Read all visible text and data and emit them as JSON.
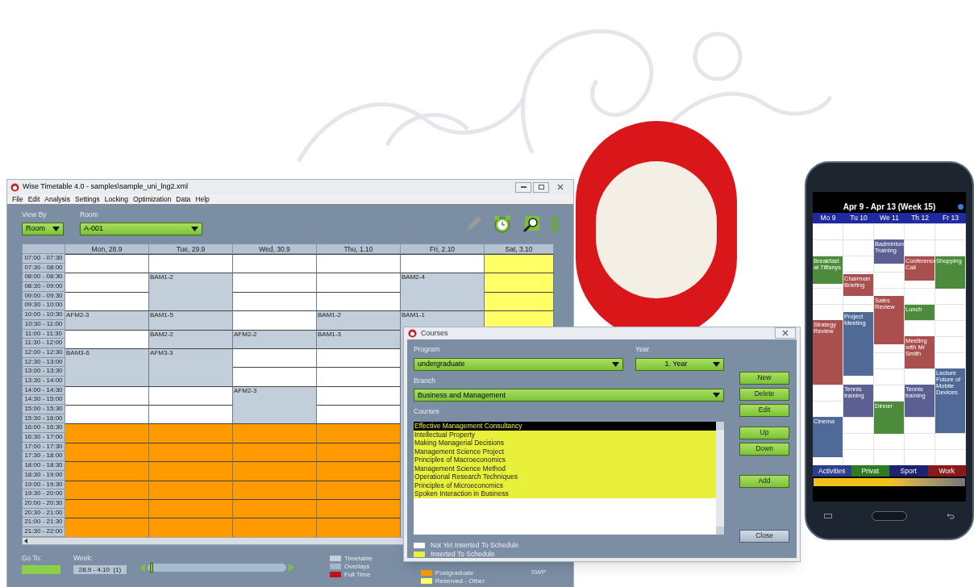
{
  "window": {
    "title": "Wise Timetable 4.0 - samples\\sample_uni_lng2.xml",
    "menu": [
      "File",
      "Edit",
      "Analysis",
      "Settings",
      "Locking",
      "Optimization",
      "Data",
      "Help"
    ]
  },
  "toolbar": {
    "view_by": {
      "label": "View By",
      "value": "Room"
    },
    "room": {
      "label": "Room",
      "value": "A-001"
    }
  },
  "timetable": {
    "days": [
      "Mon, 28.9",
      "Tue, 29.9",
      "Wed, 30.9",
      "Thu, 1.10",
      "Fri, 2.10",
      "Sat, 3.10"
    ],
    "rows": [
      {
        "time": "07:00 - 07:30",
        "cells": [
          {
            "kind": "free",
            "start": true
          },
          {
            "kind": "free",
            "start": true
          },
          {
            "kind": "free",
            "start": true
          },
          {
            "kind": "free",
            "start": true
          },
          {
            "kind": "free",
            "start": true
          },
          {
            "kind": "reserved",
            "start": true
          }
        ]
      },
      {
        "time": "07:30 - 08:00",
        "cells": [
          {
            "kind": "free",
            "start": false
          },
          {
            "kind": "free",
            "start": false
          },
          {
            "kind": "free",
            "start": false
          },
          {
            "kind": "free",
            "start": false
          },
          {
            "kind": "free",
            "start": false
          },
          {
            "kind": "reserved",
            "start": false
          }
        ]
      },
      {
        "time": "08:00 - 08:30",
        "cells": [
          {
            "kind": "free",
            "start": true
          },
          {
            "kind": "booked",
            "start": true,
            "label": "BAM1-2"
          },
          {
            "kind": "free",
            "start": true
          },
          {
            "kind": "free",
            "start": true
          },
          {
            "kind": "booked",
            "start": true,
            "label": "BAM2-4"
          },
          {
            "kind": "reserved",
            "start": true
          }
        ]
      },
      {
        "time": "08:30 - 09:00",
        "cells": [
          {
            "kind": "free",
            "start": false
          },
          {
            "kind": "booked",
            "start": false
          },
          {
            "kind": "free",
            "start": false
          },
          {
            "kind": "free",
            "start": false
          },
          {
            "kind": "booked",
            "start": false
          },
          {
            "kind": "reserved",
            "start": false
          }
        ]
      },
      {
        "time": "09:00 - 09:30",
        "cells": [
          {
            "kind": "free",
            "start": true
          },
          {
            "kind": "booked",
            "start": false
          },
          {
            "kind": "free",
            "start": true
          },
          {
            "kind": "free",
            "start": true
          },
          {
            "kind": "booked",
            "start": false
          },
          {
            "kind": "reserved",
            "start": true
          }
        ]
      },
      {
        "time": "09:30 - 10:00",
        "cells": [
          {
            "kind": "free",
            "start": false
          },
          {
            "kind": "booked",
            "start": false
          },
          {
            "kind": "free",
            "start": false
          },
          {
            "kind": "free",
            "start": false
          },
          {
            "kind": "booked",
            "start": false
          },
          {
            "kind": "reserved",
            "start": false
          }
        ]
      },
      {
        "time": "10:00 - 10:30",
        "cells": [
          {
            "kind": "booked",
            "start": true,
            "label": "AFM2-3"
          },
          {
            "kind": "booked",
            "start": true,
            "label": "BAM1-5"
          },
          {
            "kind": "free",
            "start": true
          },
          {
            "kind": "booked",
            "start": true,
            "label": "BAM1-2"
          },
          {
            "kind": "booked",
            "start": true,
            "label": "BAM1-1"
          },
          {
            "kind": "reserved",
            "start": true
          }
        ]
      },
      {
        "time": "10:30 - 11:00",
        "cells": [
          {
            "kind": "booked",
            "start": false
          },
          {
            "kind": "booked",
            "start": false
          },
          {
            "kind": "free",
            "start": false
          },
          {
            "kind": "booked",
            "start": false
          },
          {
            "kind": "booked",
            "start": false
          },
          {
            "kind": "reserved",
            "start": false
          }
        ]
      },
      {
        "time": "11:00 - 11:30",
        "cells": [
          {
            "kind": "free",
            "start": true
          },
          {
            "kind": "booked",
            "start": true,
            "label": "BAM2-2"
          },
          {
            "kind": "booked",
            "start": true,
            "label": "AFM2-2"
          },
          {
            "kind": "booked",
            "start": true,
            "label": "BAM1-3"
          }
        ]
      },
      {
        "time": "11:30 - 12:00",
        "cells": [
          {
            "kind": "free",
            "start": false
          },
          {
            "kind": "booked",
            "start": false
          },
          {
            "kind": "booked",
            "start": false
          },
          {
            "kind": "booked",
            "start": false
          }
        ]
      },
      {
        "time": "12:00 - 12:30",
        "cells": [
          {
            "kind": "booked",
            "start": true,
            "label": "BAM3-6"
          },
          {
            "kind": "booked",
            "start": true,
            "label": "AFM3-3"
          },
          {
            "kind": "free",
            "start": true
          },
          {
            "kind": "free",
            "start": true
          }
        ]
      },
      {
        "time": "12:30 - 13:00",
        "cells": [
          {
            "kind": "booked",
            "start": false
          },
          {
            "kind": "booked",
            "start": false
          },
          {
            "kind": "free",
            "start": false
          },
          {
            "kind": "free",
            "start": false
          }
        ]
      },
      {
        "time": "13:00 - 13:30",
        "cells": [
          {
            "kind": "booked",
            "start": false
          },
          {
            "kind": "booked",
            "start": false
          },
          {
            "kind": "free",
            "start": true
          },
          {
            "kind": "free",
            "start": true
          }
        ]
      },
      {
        "time": "13:30 - 14:00",
        "cells": [
          {
            "kind": "booked",
            "start": false
          },
          {
            "kind": "booked",
            "start": false
          },
          {
            "kind": "free",
            "start": false
          },
          {
            "kind": "free",
            "start": false
          }
        ]
      },
      {
        "time": "14:00 - 14:30",
        "cells": [
          {
            "kind": "free",
            "start": true
          },
          {
            "kind": "free",
            "start": true
          },
          {
            "kind": "booked",
            "start": true,
            "label": "AFM2-3"
          },
          {
            "kind": "free",
            "start": true
          }
        ]
      },
      {
        "time": "14:30 - 15:00",
        "cells": [
          {
            "kind": "free",
            "start": false
          },
          {
            "kind": "free",
            "start": false
          },
          {
            "kind": "booked",
            "start": false
          },
          {
            "kind": "free",
            "start": false
          }
        ]
      },
      {
        "time": "15:00 - 15:30",
        "cells": [
          {
            "kind": "free",
            "start": true
          },
          {
            "kind": "free",
            "start": true
          },
          {
            "kind": "booked",
            "start": false
          },
          {
            "kind": "free",
            "start": true
          }
        ]
      },
      {
        "time": "15:30 - 16:00",
        "cells": [
          {
            "kind": "free",
            "start": false
          },
          {
            "kind": "free",
            "start": false
          },
          {
            "kind": "booked",
            "start": false
          },
          {
            "kind": "free",
            "start": false
          }
        ]
      },
      {
        "time": "16:00 - 16:30",
        "cells": [
          {
            "kind": "postgraduate",
            "start": true
          },
          {
            "kind": "postgraduate",
            "start": true
          },
          {
            "kind": "postgraduate",
            "start": true
          },
          {
            "kind": "postgraduate",
            "start": true
          }
        ]
      },
      {
        "time": "16:30 - 17:00",
        "cells": [
          {
            "kind": "postgraduate",
            "start": false
          },
          {
            "kind": "postgraduate",
            "start": false
          },
          {
            "kind": "postgraduate",
            "start": false
          },
          {
            "kind": "postgraduate",
            "start": false
          }
        ]
      },
      {
        "time": "17:00 - 17:30",
        "cells": [
          {
            "kind": "postgraduate",
            "start": true
          },
          {
            "kind": "postgraduate",
            "start": true
          },
          {
            "kind": "postgraduate",
            "start": true
          },
          {
            "kind": "postgraduate",
            "start": true
          }
        ]
      },
      {
        "time": "17:30 - 18:00",
        "cells": [
          {
            "kind": "postgraduate",
            "start": false
          },
          {
            "kind": "postgraduate",
            "start": false
          },
          {
            "kind": "postgraduate",
            "start": false
          },
          {
            "kind": "postgraduate",
            "start": false
          }
        ]
      },
      {
        "time": "18:00 - 18:30",
        "cells": [
          {
            "kind": "postgraduate",
            "start": true
          },
          {
            "kind": "postgraduate",
            "start": true
          },
          {
            "kind": "postgraduate",
            "start": true
          },
          {
            "kind": "postgraduate",
            "start": true
          }
        ]
      },
      {
        "time": "18:30 - 19:00",
        "cells": [
          {
            "kind": "postgraduate",
            "start": false
          },
          {
            "kind": "postgraduate",
            "start": false
          },
          {
            "kind": "postgraduate",
            "start": false
          },
          {
            "kind": "postgraduate",
            "start": false
          }
        ]
      },
      {
        "time": "19:00 - 19:30",
        "cells": [
          {
            "kind": "postgraduate",
            "start": true
          },
          {
            "kind": "postgraduate",
            "start": true
          },
          {
            "kind": "postgraduate",
            "start": true
          },
          {
            "kind": "postgraduate",
            "start": true
          }
        ]
      },
      {
        "time": "19:30 - 20:00",
        "cells": [
          {
            "kind": "postgraduate",
            "start": false
          },
          {
            "kind": "postgraduate",
            "start": false
          },
          {
            "kind": "postgraduate",
            "start": false
          },
          {
            "kind": "postgraduate",
            "start": false
          }
        ]
      },
      {
        "time": "20:00 - 20:30",
        "cells": [
          {
            "kind": "postgraduate",
            "start": true
          },
          {
            "kind": "postgraduate",
            "start": true
          },
          {
            "kind": "postgraduate",
            "start": true
          },
          {
            "kind": "postgraduate",
            "start": true
          }
        ]
      },
      {
        "time": "20:30 - 21:00",
        "cells": [
          {
            "kind": "postgraduate",
            "start": false
          },
          {
            "kind": "postgraduate",
            "start": false
          },
          {
            "kind": "postgraduate",
            "start": false
          },
          {
            "kind": "postgraduate",
            "start": false
          }
        ]
      },
      {
        "time": "21:00 - 21:30",
        "cells": [
          {
            "kind": "postgraduate",
            "start": true
          },
          {
            "kind": "postgraduate",
            "start": true
          },
          {
            "kind": "postgraduate",
            "start": true
          },
          {
            "kind": "postgraduate",
            "start": true
          }
        ]
      },
      {
        "time": "21:30 - 22:00",
        "cells": [
          {
            "kind": "postgraduate",
            "start": false
          },
          {
            "kind": "postgraduate",
            "start": false
          },
          {
            "kind": "postgraduate",
            "start": false
          },
          {
            "kind": "postgraduate",
            "start": false
          }
        ]
      }
    ]
  },
  "footer": {
    "go_to": {
      "label": "Go To:"
    },
    "week": {
      "label": "Week:",
      "value": "28.9 - 4.10  (1)"
    },
    "week_slider": {
      "level": 0.02
    },
    "legend": [
      {
        "label": "Timetable",
        "color": "#c5d0dc"
      },
      {
        "label": "Overlays",
        "color": "#a6b6c9"
      },
      {
        "label": "Full Time",
        "color": "#c0101a"
      }
    ],
    "legend_2": [
      {
        "label": "Postgraduate",
        "color": "#ff9a00"
      },
      {
        "label": "Reserved - Other",
        "color": "#ffff66"
      }
    ],
    "code": "SWP"
  },
  "courses_dialog": {
    "title": "Courses",
    "program": {
      "label": "Program",
      "value": "undergraduate"
    },
    "year": {
      "label": "Year",
      "value": "1. Year"
    },
    "branch": {
      "label": "Branch",
      "value": "Business and Management"
    },
    "courses_label": "Courses",
    "courses": [
      {
        "name": "Effective Management Consultancy",
        "selected": true,
        "inserted": true
      },
      {
        "name": "Intellectual Property",
        "selected": false,
        "inserted": true
      },
      {
        "name": "Making Managerial Decisions",
        "selected": false,
        "inserted": true
      },
      {
        "name": "Management Science Project",
        "selected": false,
        "inserted": true
      },
      {
        "name": "Principles of Macroeconomics",
        "selected": false,
        "inserted": true
      },
      {
        "name": "Management Science Method",
        "selected": false,
        "inserted": true
      },
      {
        "name": "Operational Research Techniques",
        "selected": false,
        "inserted": true
      },
      {
        "name": "Principles of Microeconomics",
        "selected": false,
        "inserted": true
      },
      {
        "name": "Spoken Interaction in Business",
        "selected": false,
        "inserted": true
      }
    ],
    "buttons": [
      "New",
      "Delete",
      "Edit",
      "Up",
      "Down",
      "Add",
      "Close"
    ],
    "legend": [
      {
        "label": "Not Yet Inserted To Schedule",
        "color": "#ffffff"
      },
      {
        "label": "Inserted To Schedule",
        "color": "#e8f03a"
      }
    ]
  },
  "phone": {
    "title": "Apr 9 - Apr 13 (Week 15)",
    "days": [
      "Mo 9",
      "Tu 10",
      "We 11",
      "Th 12",
      "Fr 13"
    ],
    "events": [
      {
        "title": "Badminton Training",
        "color": "#5b5f92"
      },
      {
        "title": "Breakfast at Tiffanys",
        "color": "#4c8a3c"
      },
      {
        "title": "Conference Call",
        "color": "#a9504f"
      },
      {
        "title": "Shopping",
        "color": "#4c8a3c"
      },
      {
        "title": "Chairman Briefing",
        "color": "#a9504f"
      },
      {
        "title": "Sales Review",
        "color": "#a9504f"
      },
      {
        "title": "Lunch",
        "color": "#4c8a3c"
      },
      {
        "title": "Project Meeting",
        "color": "#4f6a97"
      },
      {
        "title": "Strategy Review",
        "color": "#a9504f"
      },
      {
        "title": "Meeting with Mr Smith",
        "color": "#a9504f"
      },
      {
        "title": "Tennis training",
        "color": "#5b5f92"
      },
      {
        "title": "Dinner",
        "color": "#4c8a3c"
      },
      {
        "title": "Tennis training",
        "color": "#5b5f92"
      },
      {
        "title": "Lecture Future of Mobile Devices",
        "color": "#4f6a97"
      },
      {
        "title": "Cinema",
        "color": "#4f6a97"
      }
    ],
    "categories": [
      {
        "label": "Activities",
        "color": "#2b3f8a"
      },
      {
        "label": "Privat",
        "color": "#2f7a25"
      },
      {
        "label": "Sport",
        "color": "#1d2370"
      },
      {
        "label": "Work",
        "color": "#8a1a1a"
      }
    ]
  }
}
